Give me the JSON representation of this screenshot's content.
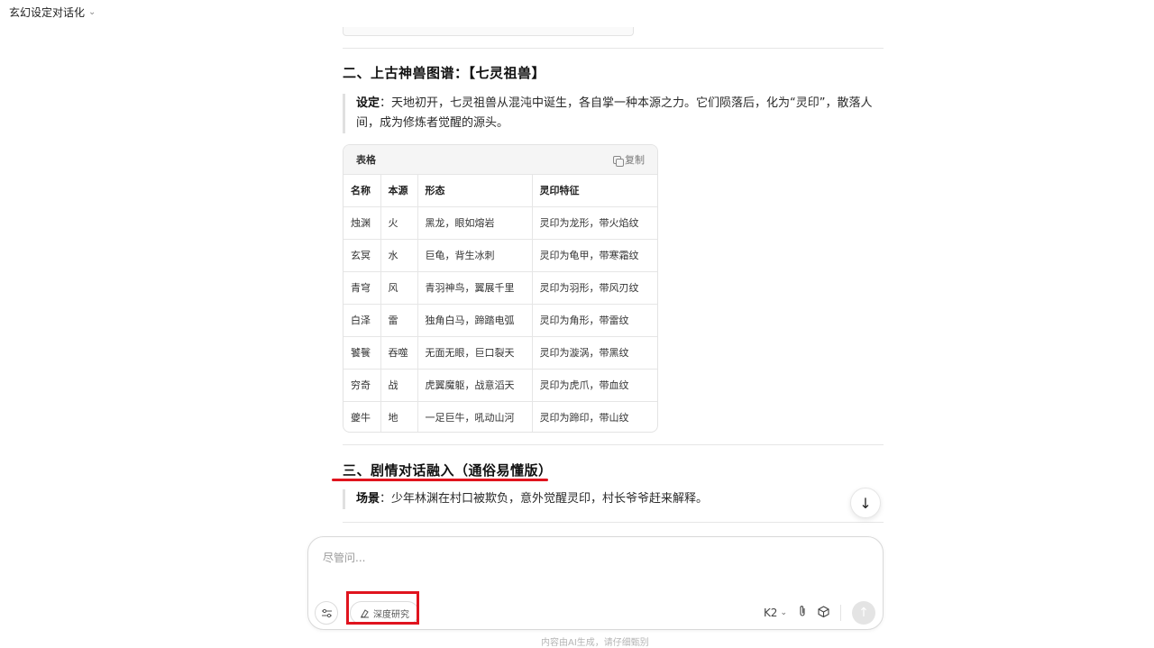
{
  "header": {
    "title": "玄幻设定对话化",
    "chevron": "chevron-down-icon"
  },
  "section2": {
    "heading": "二、上古神兽图谱：【七灵祖兽】",
    "quote_label": "设定",
    "quote_text": "：天地初开，七灵祖兽从混沌中诞生，各自掌一种本源之力。它们陨落后，化为“灵印”，散落人间，成为修炼者觉醒的源头。"
  },
  "table": {
    "label": "表格",
    "copy_label": "复制",
    "headers": [
      "名称",
      "本源",
      "形态",
      "灵印特征"
    ],
    "rows": [
      [
        "烛渊",
        "火",
        "黑龙，眼如熔岩",
        "灵印为龙形，带火焰纹"
      ],
      [
        "玄冥",
        "水",
        "巨龟，背生冰刺",
        "灵印为龟甲，带寒霜纹"
      ],
      [
        "青穹",
        "风",
        "青羽神鸟，翼展千里",
        "灵印为羽形，带风刃纹"
      ],
      [
        "白泽",
        "雷",
        "独角白马，蹄踏电弧",
        "灵印为角形，带雷纹"
      ],
      [
        "饕餮",
        "吞噬",
        "无面无眼，巨口裂天",
        "灵印为漩涡，带黑纹"
      ],
      [
        "穷奇",
        "战",
        "虎翼魔躯，战意滔天",
        "灵印为虎爪，带血纹"
      ],
      [
        "夔牛",
        "地",
        "一足巨牛，吼动山河",
        "灵印为蹄印，带山纹"
      ]
    ]
  },
  "section3": {
    "heading": "三、剧情对话融入（通俗易懂版）",
    "quote_label": "场景",
    "quote_text": "：少年林渊在村口被欺负，意外觉醒灵印，村长爷爷赶来解释。"
  },
  "input": {
    "placeholder": "尽管问...",
    "tools_icon": "sliders-icon",
    "deep_research_label": "深度研究",
    "model_label": "K2",
    "attach_icon": "paperclip-icon",
    "cube_icon": "cube-icon",
    "send_icon": "arrow-up-icon"
  },
  "footer": {
    "note": "内容由AI生成，请仔细甄别"
  },
  "accent_colors": {
    "annotation_red": "#e0141e"
  }
}
